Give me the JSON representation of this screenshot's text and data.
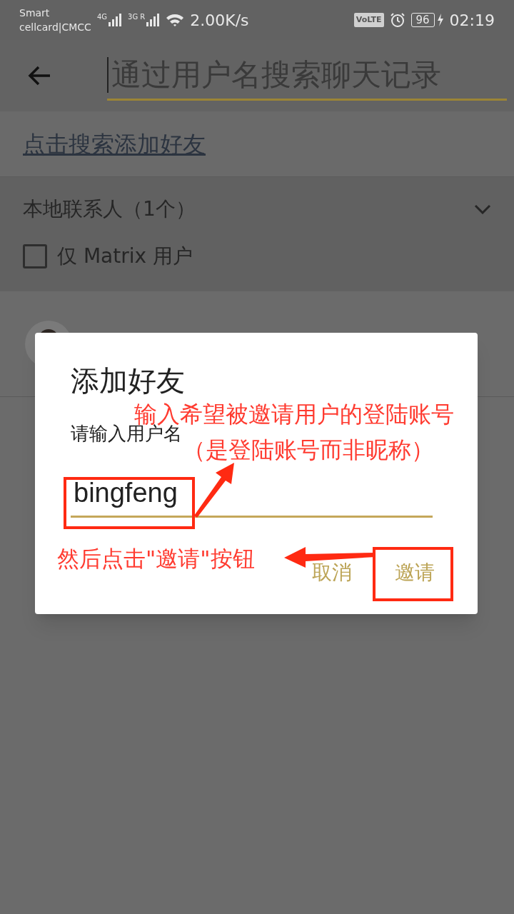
{
  "status_bar": {
    "carriers": [
      "Smart",
      "cellcard|CMCC"
    ],
    "networks": [
      {
        "label": "4G"
      },
      {
        "label": "3G R"
      }
    ],
    "speed": "2.00K/s",
    "volte": "VoLTE",
    "battery": "96",
    "charging": true,
    "time": "02:19"
  },
  "search": {
    "placeholder": "通过用户名搜索聊天记录"
  },
  "add_friend_link": "点击搜索添加好友",
  "section": {
    "title": "本地联系人（1个）",
    "expanded": true
  },
  "filter": {
    "label": "仅 Matrix 用户",
    "checked": false
  },
  "dialog": {
    "title": "添加好友",
    "label": "请输入用户名",
    "value": "bingfeng",
    "buttons": [
      "取消",
      "邀请"
    ]
  },
  "annotations": [
    {
      "text": "输入希望被邀请用户的登陆账号"
    },
    {
      "text": "（是登陆账号而非昵称）"
    },
    {
      "text": "然后点击\"邀请\"按钮"
    }
  ]
}
